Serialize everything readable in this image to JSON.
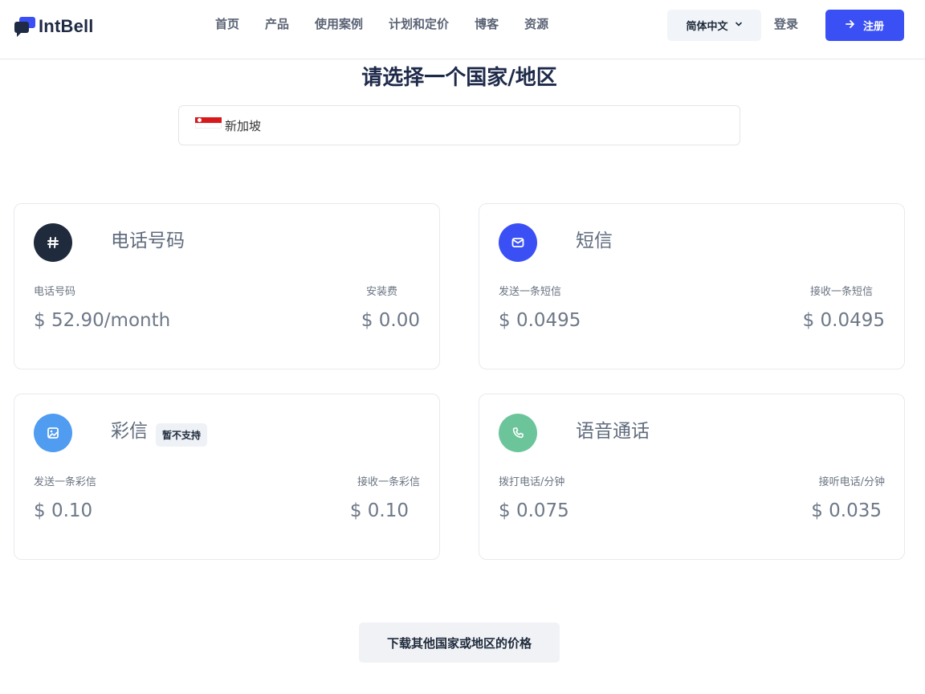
{
  "header": {
    "logo_text": "IntBell",
    "nav": [
      "首页",
      "产品",
      "使用案例",
      "计划和定价",
      "博客",
      "资源"
    ],
    "language_label": "简体中文",
    "login_label": "登录",
    "signup_label": "注册"
  },
  "country_picker": {
    "title": "请选择一个国家/地区",
    "selected_country": "新加坡",
    "flag_icon": "singapore-flag"
  },
  "cards": {
    "phone": {
      "title": "电话号码",
      "icon": "hash-icon",
      "color": "#1f2a3c",
      "left_label": "电话号码",
      "left_value": "$ 52.90/month",
      "right_label": "安装费",
      "right_value": "$ 0.00"
    },
    "sms": {
      "title": "短信",
      "icon": "envelope-icon",
      "color": "#3a50f5",
      "left_label": "发送一条短信",
      "left_value": "$ 0.0495",
      "right_label": "接收一条短信",
      "right_value": "$ 0.0495"
    },
    "mms": {
      "title": "彩信",
      "badge": "暂不支持",
      "icon": "image-icon",
      "color": "#4f9cf0",
      "left_label": "发送一条彩信",
      "left_value": "$ 0.10",
      "right_label": "接收一条彩信",
      "right_value": "$ 0.10"
    },
    "voice": {
      "title": "语音通话",
      "icon": "phone-icon",
      "color": "#6cc59a",
      "left_label": "拨打电话/分钟",
      "left_value": "$ 0.075",
      "right_label": "接听电话/分钟",
      "right_value": "$ 0.035"
    }
  },
  "download_label": "下载其他国家或地区的价格"
}
